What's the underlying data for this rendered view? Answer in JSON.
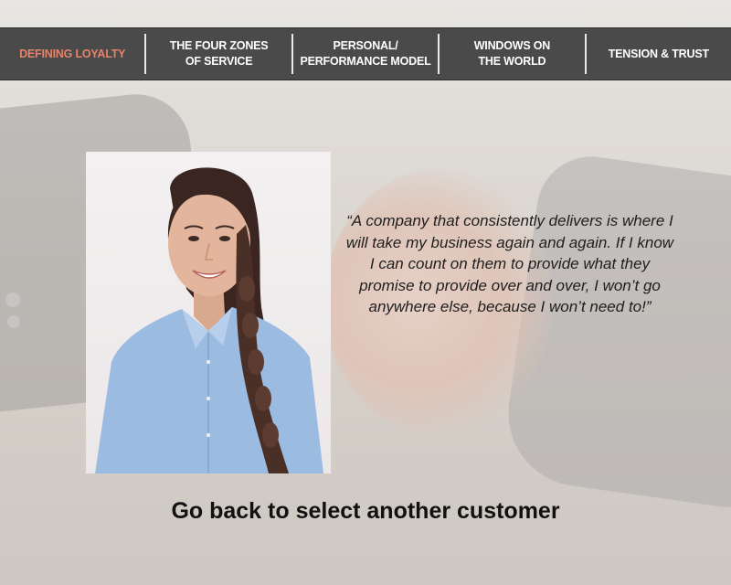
{
  "nav": {
    "items": [
      {
        "label": "DEFINING LOYALTY",
        "active": true
      },
      {
        "label": "THE FOUR ZONES\nOF SERVICE",
        "active": false
      },
      {
        "label": "PERSONAL/\nPERFORMANCE MODEL",
        "active": false
      },
      {
        "label": "WINDOWS ON\nTHE WORLD",
        "active": false
      },
      {
        "label": "TENSION & TRUST",
        "active": false
      }
    ],
    "active_color": "#e6836a",
    "background_color": "#4a4a4a"
  },
  "quote": {
    "text": "“A company that consistently delivers is where I will take my business again and again. If I know I can count on them to provide what they promise to provide over and over, I won’t go anywhere else, because I won’t need to!”"
  },
  "back_link": {
    "label": "Go back to select another customer"
  }
}
